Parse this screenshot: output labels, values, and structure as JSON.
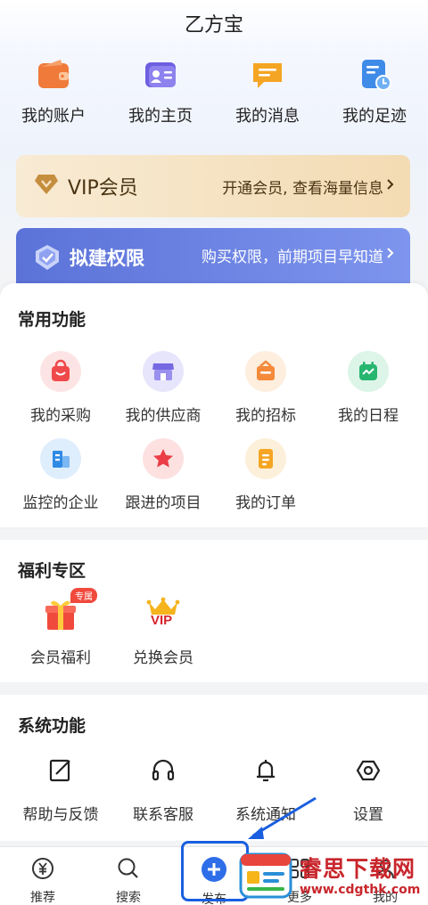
{
  "header": {
    "title": "乙方宝"
  },
  "top_menu": [
    {
      "label": "我的账户",
      "icon": "wallet-icon"
    },
    {
      "label": "我的主页",
      "icon": "profile-card-icon"
    },
    {
      "label": "我的消息",
      "icon": "message-icon"
    },
    {
      "label": "我的足迹",
      "icon": "history-icon"
    }
  ],
  "vip_banner": {
    "title": "VIP会员",
    "action": "开通会员, 查看海量信息",
    "color": "#f3dbb3"
  },
  "permission_banner": {
    "title": "拟建权限",
    "action": "购买权限，前期项目早知道",
    "color": "#5b72d8"
  },
  "common_functions": {
    "title": "常用功能",
    "items": [
      {
        "label": "我的采购",
        "icon": "shopping-bag-icon"
      },
      {
        "label": "我的供应商",
        "icon": "store-icon"
      },
      {
        "label": "我的招标",
        "icon": "bidding-icon"
      },
      {
        "label": "我的日程",
        "icon": "calendar-icon"
      },
      {
        "label": "监控的企业",
        "icon": "building-icon"
      },
      {
        "label": "跟进的项目",
        "icon": "star-icon"
      },
      {
        "label": "我的订单",
        "icon": "order-icon"
      }
    ]
  },
  "welfare": {
    "title": "福利专区",
    "badge": "专属",
    "vip_mark": "VIP",
    "items": [
      {
        "label": "会员福利",
        "icon": "gift-icon"
      },
      {
        "label": "兑换会员",
        "icon": "crown-vip-icon"
      }
    ]
  },
  "system_functions": {
    "title": "系统功能",
    "items": [
      {
        "label": "帮助与反馈",
        "icon": "feedback-icon"
      },
      {
        "label": "联系客服",
        "icon": "headset-icon"
      },
      {
        "label": "系统通知",
        "icon": "bell-icon"
      },
      {
        "label": "设置",
        "icon": "settings-icon"
      }
    ]
  },
  "bottom_nav": [
    {
      "label": "推荐",
      "icon": "yen-icon"
    },
    {
      "label": "搜索",
      "icon": "search-icon"
    },
    {
      "label": "发布",
      "icon": "plus-icon"
    },
    {
      "label": "更多",
      "icon": "more-icon"
    },
    {
      "label": "我的",
      "icon": "user-icon"
    }
  ],
  "watermark": {
    "title": "睿思下载网",
    "url": "www.cdgthk.com"
  }
}
